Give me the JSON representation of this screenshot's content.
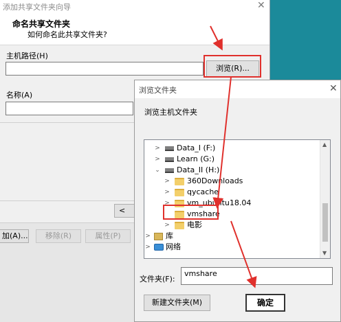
{
  "wizard": {
    "title": "添加共享文件夹向导",
    "header_title": "命名共享文件夹",
    "header_subtitle": "如何命名此共享文件夹?",
    "host_path_label": "主机路径(H)",
    "host_path_value": "",
    "browse_label": "浏览(R)...",
    "name_label": "名称(A)",
    "name_value": "",
    "prev_label": "< 上",
    "add_label": "加(A)...",
    "remove_label": "移除(R)",
    "properties_label": "属性(P)"
  },
  "dialog": {
    "title": "浏览文件夹",
    "subtitle": "浏览主机文件夹",
    "folder_label": "文件夹(F):",
    "folder_value": "vmshare",
    "new_folder_label": "新建文件夹(M)",
    "ok_label": "确定",
    "tree": [
      {
        "label": "Data_I (F:)",
        "icon": "drive-icon",
        "expander": "collapsed"
      },
      {
        "label": "Learn (G:)",
        "icon": "drive-icon",
        "expander": "collapsed"
      },
      {
        "label": "Data_II (H:)",
        "icon": "drive-icon",
        "expander": "expanded"
      },
      {
        "label": "360Downloads",
        "icon": "folder-icon",
        "expander": "collapsed"
      },
      {
        "label": "qycache",
        "icon": "folder-icon",
        "expander": "collapsed"
      },
      {
        "label": "vm_ubuntu18.04",
        "icon": "folder-icon",
        "expander": "collapsed"
      },
      {
        "label": "vmshare",
        "icon": "folder-icon",
        "expander": "none"
      },
      {
        "label": "电影",
        "icon": "folder-icon",
        "expander": "collapsed"
      },
      {
        "label": "库",
        "icon": "library-icon",
        "expander": "collapsed"
      },
      {
        "label": "网络",
        "icon": "network-icon",
        "expander": "collapsed"
      }
    ]
  },
  "colors": {
    "highlight": "#e0302c",
    "desktop": "#1b8a9a"
  }
}
